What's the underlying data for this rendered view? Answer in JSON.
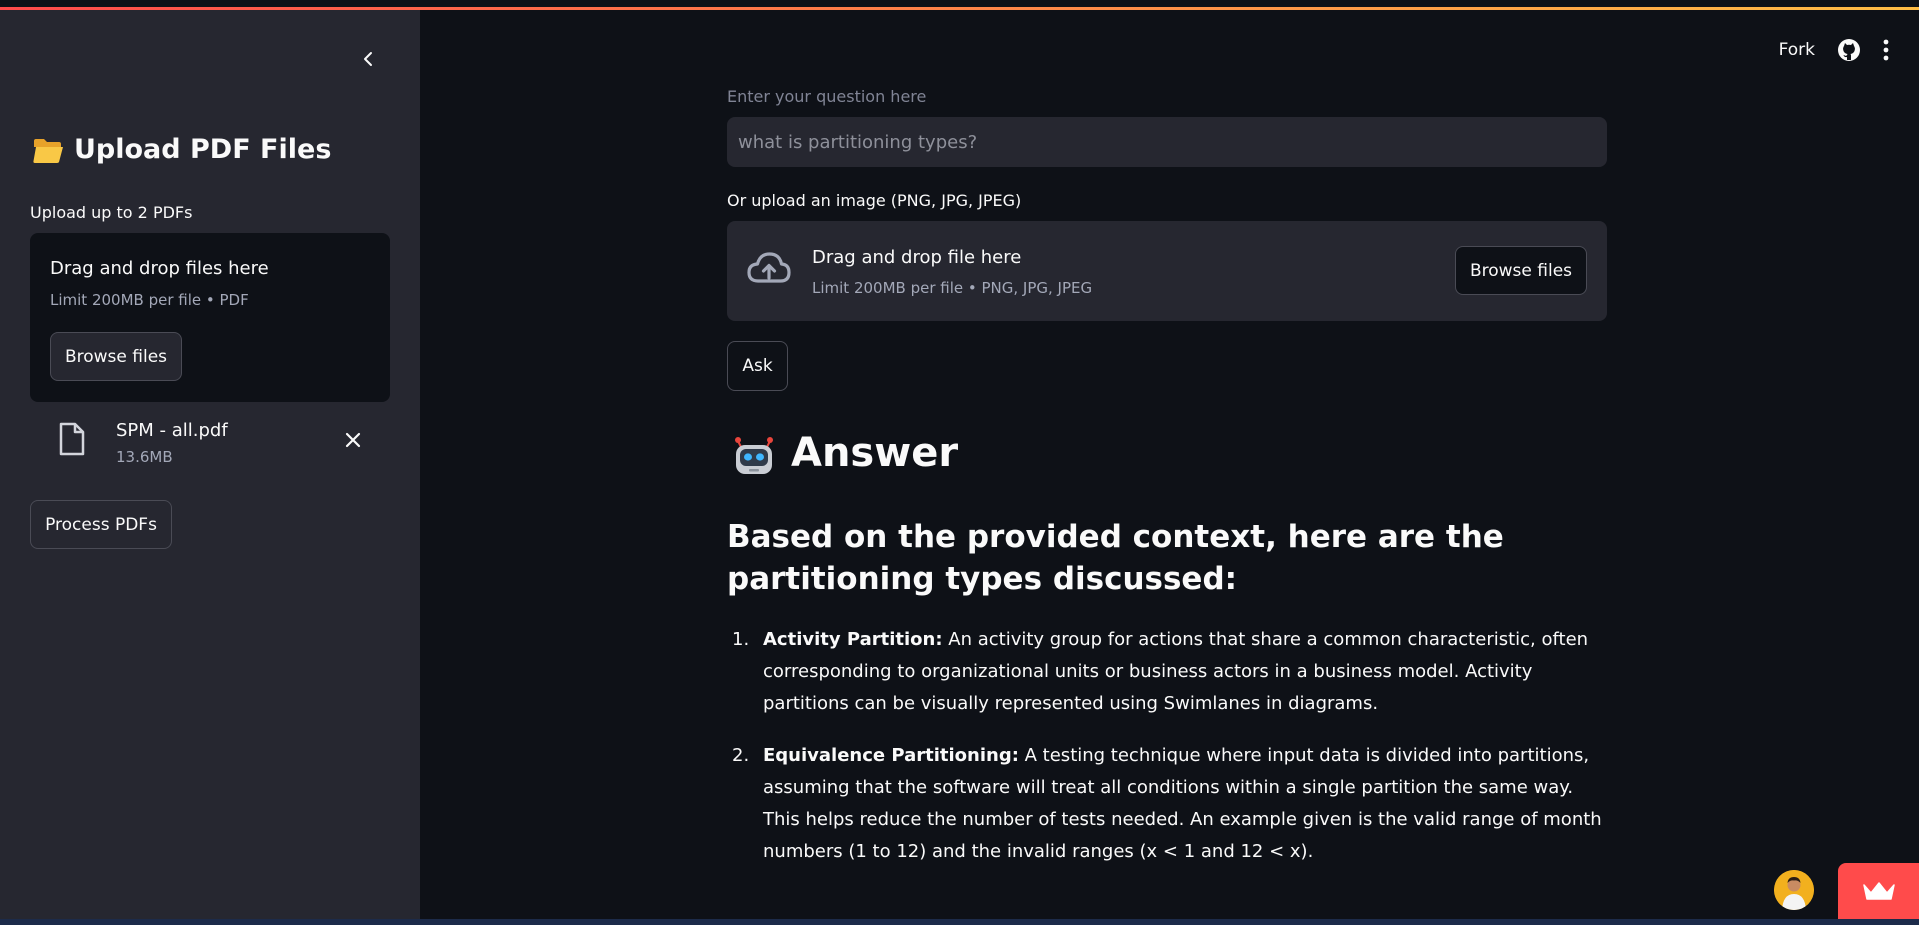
{
  "sidebar": {
    "title": "Upload PDF Files",
    "title_icon": "folder-icon",
    "upload_hint": "Upload up to 2 PDFs",
    "dropzone": {
      "title": "Drag and drop files here",
      "limit": "Limit 200MB per file • PDF",
      "browse_label": "Browse files"
    },
    "file": {
      "name": "SPM - all.pdf",
      "size": "13.6MB"
    },
    "process_label": "Process PDFs"
  },
  "header": {
    "fork_label": "Fork"
  },
  "main": {
    "question_label": "Enter your question here",
    "question_placeholder": "what is partitioning types?",
    "image_label": "Or upload an image (PNG, JPG, JPEG)",
    "image_dropzone": {
      "title": "Drag and drop file here",
      "limit": "Limit 200MB per file • PNG, JPG, JPEG",
      "browse_label": "Browse files"
    },
    "ask_label": "Ask",
    "answer_title": "Answer",
    "answer_subtitle": "Based on the provided context, here are the partitioning types discussed:",
    "answer_items": [
      {
        "num": "1.",
        "term": "Activity Partition:",
        "text": " An activity group for actions that share a common characteristic, often corresponding to organizational units or business actors in a business model. Activity partitions can be visually represented using Swimlanes in diagrams."
      },
      {
        "num": "2.",
        "term": "Equivalence Partitioning:",
        "text": " A testing technique where input data is divided into partitions, assuming that the software will treat all conditions within a single partition the same way. This helps reduce the number of tests needed. An example given is the valid range of month numbers (1 to 12) and the invalid ranges (x < 1 and 12 < x)."
      }
    ]
  },
  "colors": {
    "background": "#0e1117",
    "sidebar": "#262730",
    "accent": "#ff4b4b"
  }
}
